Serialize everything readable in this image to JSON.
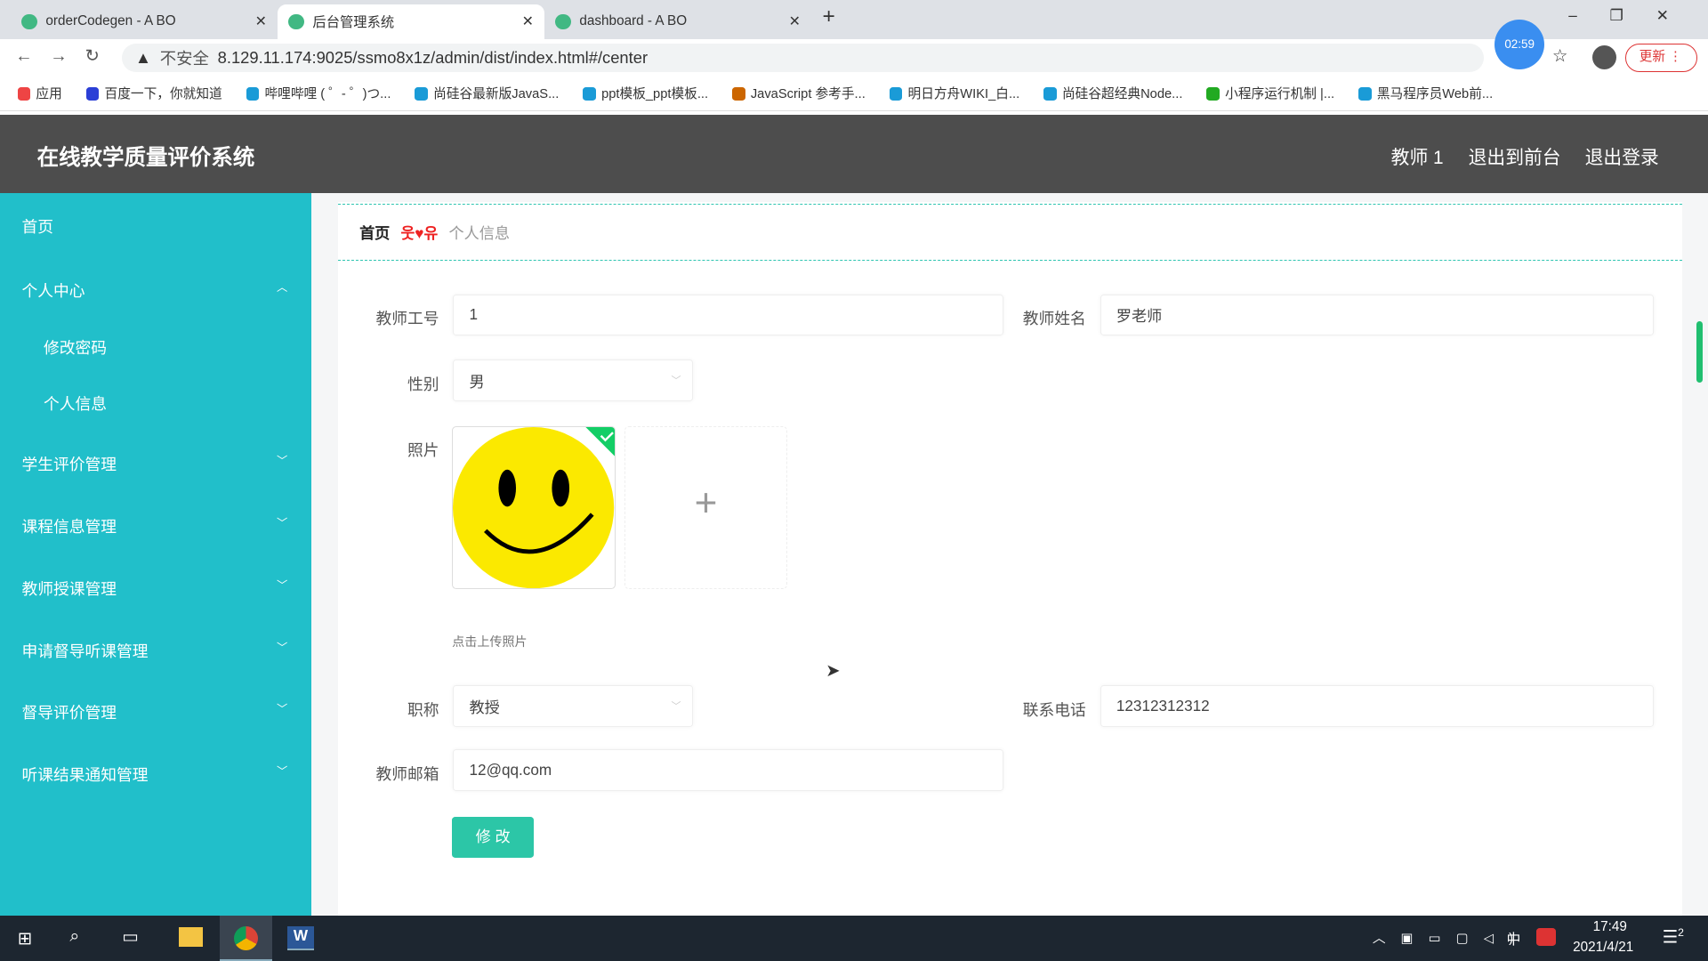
{
  "browser": {
    "tabs": [
      {
        "title": "orderCodegen - A BO"
      },
      {
        "title": "后台管理系统"
      },
      {
        "title": "dashboard - A BO"
      }
    ],
    "security": "不安全",
    "url": "8.129.11.174:9025/ssmo8x1z/admin/dist/index.html#/center",
    "timer": "02:59",
    "update_label": "更新",
    "bookmarks": [
      "应用",
      "百度一下，你就知道",
      "哔哩哔哩 ( ゜- ゜)つ...",
      "尚硅谷最新版JavaS...",
      "ppt模板_ppt模板...",
      "JavaScript 参考手...",
      "明日方舟WIKI_白...",
      "尚硅谷超经典Node...",
      "小程序运行机制 |...",
      "黑马程序员Web前..."
    ]
  },
  "header": {
    "title": "在线教学质量评价系统",
    "user": "教师 1",
    "front": "退出到前台",
    "logout": "退出登录"
  },
  "sidebar": {
    "items": [
      {
        "label": "首页"
      },
      {
        "label": "个人中心"
      },
      {
        "label": "修改密码"
      },
      {
        "label": "个人信息"
      },
      {
        "label": "学生评价管理"
      },
      {
        "label": "课程信息管理"
      },
      {
        "label": "教师授课管理"
      },
      {
        "label": "申请督导听课管理"
      },
      {
        "label": "督导评价管理"
      },
      {
        "label": "听课结果通知管理"
      }
    ]
  },
  "breadcrumb": {
    "home": "首页",
    "sep": "웃♥유",
    "current": "个人信息"
  },
  "form": {
    "id_label": "教师工号",
    "id": "1",
    "name_label": "教师姓名",
    "name": "罗老师",
    "gender_label": "性别",
    "gender": "男",
    "photo_label": "照片",
    "photo_hint": "点击上传照片",
    "title_label": "职称",
    "title": "教授",
    "phone_label": "联系电话",
    "phone": "12312312312",
    "email_label": "教师邮箱",
    "email": "12@qq.com",
    "submit": "修 改"
  },
  "taskbar": {
    "time": "17:49",
    "date": "2021/4/21",
    "ime": "中",
    "notif": "2"
  }
}
